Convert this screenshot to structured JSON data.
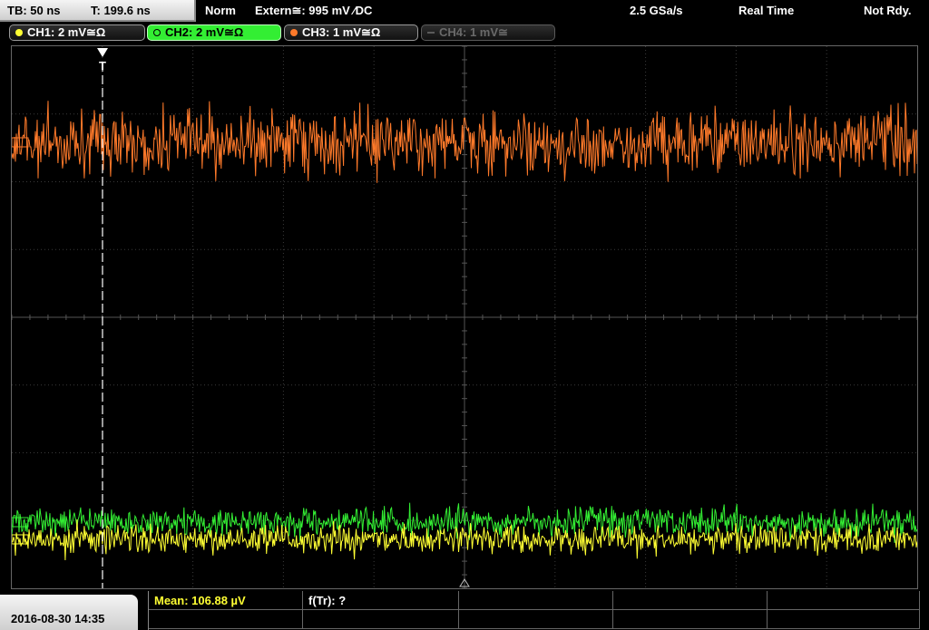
{
  "topbar": {
    "timebase": "TB: 50 ns",
    "trigger_time": "T: 199.6 ns",
    "trigger_mode": "Norm",
    "trigger_source": "Extern≅: 995 mV ∕DC",
    "sample_rate": "2.5 GSa/s",
    "acq_mode": "Real Time",
    "status": "Not Rdy."
  },
  "channels": [
    {
      "label": "CH1: 2 mV≅Ω",
      "color": "#ffff33",
      "active": true
    },
    {
      "label": "CH2: 2 mV≅Ω",
      "color": "#33ee33",
      "active": true,
      "selected": true
    },
    {
      "label": "CH3: 1 mV≅Ω",
      "color": "#ff7a2a",
      "active": true
    },
    {
      "label": "CH4: 1 mV≅",
      "color": "#6a6a6a",
      "active": false
    }
  ],
  "trigger_marker": "T",
  "bottombar": {
    "datetime": "2016-08-30 14:35",
    "measurements": [
      {
        "label": "Mean: 106.88 µV",
        "color": "#ffff33"
      },
      {
        "label": "f(Tr): ?",
        "color": "#ffffff"
      }
    ]
  },
  "colors": {
    "ch1": "#ffff33",
    "ch2": "#33ee33",
    "ch3": "#ff7a2a",
    "grid": "#3a3a3a"
  }
}
